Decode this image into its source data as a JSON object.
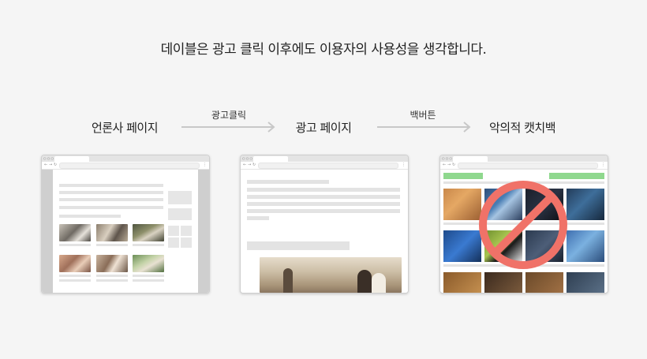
{
  "headline": "데이블은 광고 클릭 이후에도 이용자의 사용성을 생각합니다.",
  "stages": [
    {
      "label": "언론사 페이지"
    },
    {
      "label": "광고 페이지"
    },
    {
      "label": "악의적 캣치백"
    }
  ],
  "transitions": [
    {
      "label": "광고클릭"
    },
    {
      "label": "백버튼"
    }
  ],
  "colors": {
    "background": "#f5f5f5",
    "arrow": "#c8c8c8",
    "placeholder": "#e3e3e3",
    "side_gray": "#cfcfcf",
    "prohibit": "#f07268",
    "green_bar": "#8fd88e"
  },
  "icons": {
    "back": "back-arrow-icon",
    "forward": "forward-arrow-icon",
    "reload": "reload-icon",
    "menu": "more-vertical-icon",
    "prohibit": "prohibited-sign-icon"
  }
}
